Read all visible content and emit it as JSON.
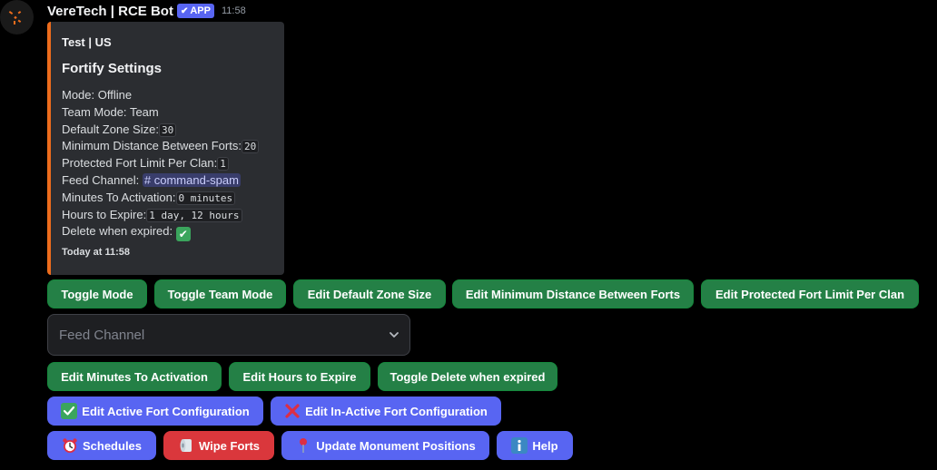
{
  "message": {
    "author": "VereTech | RCE Bot",
    "badge": "APP",
    "time": "11:58"
  },
  "embed": {
    "author": "Test | US",
    "title": "Fortify Settings",
    "accent_color": "#ed6c1c",
    "fields": {
      "mode_label": "Mode:",
      "mode_value": "Offline",
      "team_mode_label": "Team Mode:",
      "team_mode_value": "Team",
      "zone_size_label": "Default Zone Size:",
      "zone_size_value": "30",
      "min_distance_label": "Minimum Distance Between Forts:",
      "min_distance_value": "20",
      "fort_limit_label": "Protected Fort Limit Per Clan:",
      "fort_limit_value": "1",
      "feed_channel_label": "Feed Channel:",
      "feed_channel_value": "# command-spam",
      "activation_label": "Minutes To Activation:",
      "activation_value": "0 minutes",
      "expire_label": "Hours to Expire:",
      "expire_value": "1 day, 12 hours",
      "delete_label": "Delete when expired:",
      "delete_value": "✔"
    },
    "footer": "Today at 11:58"
  },
  "buttons_row1": {
    "toggle_mode": "Toggle Mode",
    "toggle_team_mode": "Toggle Team Mode",
    "edit_zone_size": "Edit Default Zone Size",
    "edit_min_distance": "Edit Minimum Distance Between Forts",
    "edit_fort_limit": "Edit Protected Fort Limit Per Clan"
  },
  "select": {
    "placeholder": "Feed Channel"
  },
  "buttons_row2": {
    "edit_activation": "Edit Minutes To Activation",
    "edit_expire": "Edit Hours to Expire",
    "toggle_delete": "Toggle Delete when expired"
  },
  "buttons_row3": {
    "edit_active": "Edit Active Fort Configuration",
    "edit_inactive": "Edit In-Active Fort Configuration"
  },
  "buttons_row4": {
    "schedules": "Schedules",
    "wipe_forts": "Wipe Forts",
    "update_monuments": "Update Monument Positions",
    "help": "Help"
  },
  "colors": {
    "green": "#248046",
    "blurple": "#5865f2",
    "red": "#da373c"
  }
}
